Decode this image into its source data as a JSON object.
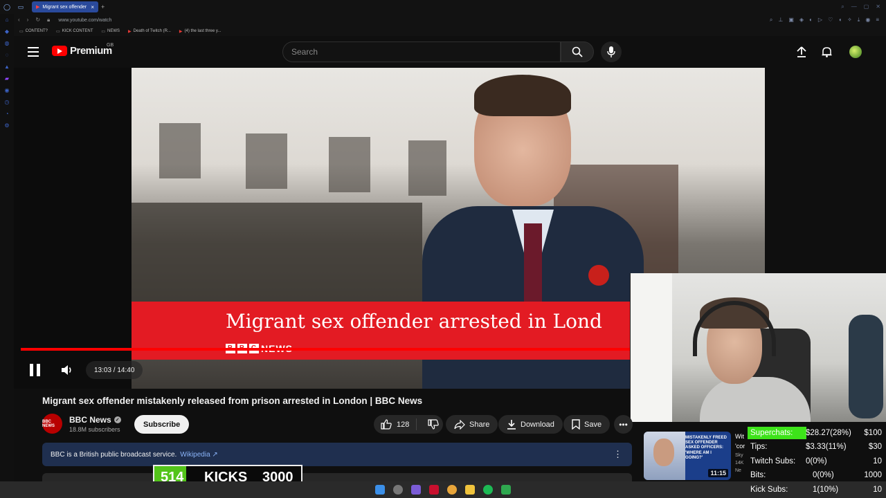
{
  "browser": {
    "tab_title": "Migrant sex offender",
    "url": "www.youtube.com/watch",
    "bookmarks": [
      {
        "label": "CONTENT?",
        "icon": "folder-icon"
      },
      {
        "label": "KICK CONTENT",
        "icon": "folder-icon"
      },
      {
        "label": "NEWS",
        "icon": "folder-icon"
      },
      {
        "label": "Death of Twitch (R...",
        "icon": "youtube-icon"
      },
      {
        "label": "(4) the last three y...",
        "icon": "youtube-icon"
      }
    ]
  },
  "header": {
    "brand": "Premium",
    "region": "GB",
    "search_placeholder": "Search"
  },
  "player": {
    "headline": "Migrant sex offender arrested in Lond",
    "bbc_label": "NEWS",
    "time": "13:03 / 14:40",
    "progress_fraction": 0.889,
    "state": "playing"
  },
  "video": {
    "title": "Migrant sex offender mistakenly released from prison arrested in London | BBC News",
    "channel_name": "BBC News",
    "channel_avatar_text": "BBC NEWS",
    "subscribers": "18.8M subscribers",
    "subscribe_label": "Subscribe",
    "likes": "128",
    "share_label": "Share",
    "download_label": "Download",
    "save_label": "Save",
    "info_text": "BBC is a British public broadcast service.",
    "info_link": "Wikipedia ↗"
  },
  "kicks": {
    "current": "514",
    "label": "KICKS",
    "goal": "3000"
  },
  "related": {
    "thumb_caption": "MISTAKENLY FREED SEX OFFENDER ASKED OFFICERS: 'WHERE AM I GOING?'",
    "duration": "11:15",
    "title_fragment": "Wit",
    "title_fragment2": "'cor",
    "channel_fragment": "Sky",
    "views_fragment": "14K",
    "badge_fragment": "Ne"
  },
  "stats": [
    {
      "key": "Superchats:",
      "value": "$28.27(28%)",
      "goal": "$100",
      "highlight": true
    },
    {
      "key": "Tips:",
      "value": "$3.33(11%)",
      "goal": "$30",
      "highlight": false
    },
    {
      "key": "Twitch Subs:",
      "value": "0(0%)",
      "goal": "10",
      "highlight": false
    },
    {
      "key": "Bits:",
      "value": "0(0%)",
      "goal": "1000",
      "highlight": false
    },
    {
      "key": "Kick Subs:",
      "value": "1(10%)",
      "goal": "10",
      "highlight": false
    }
  ],
  "colors": {
    "yt_red": "#ff0000",
    "bbc_red": "#e31b23",
    "kick_green": "#53c41a",
    "highlight_green": "#3de31a",
    "info_blue": "#1f2f4f"
  }
}
